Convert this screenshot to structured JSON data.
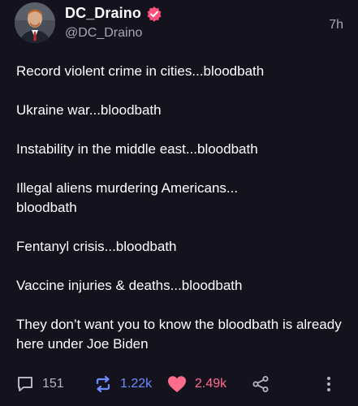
{
  "post": {
    "display_name": "DC_Draino",
    "handle": "@DC_Draino",
    "timestamp": "7h",
    "paragraphs": [
      "Record violent crime in cities...bloodbath",
      "Ukraine war...bloodbath",
      "Instability in the middle east...bloodbath",
      "Illegal aliens murdering Americans...\nbloodbath",
      "Fentanyl crisis...bloodbath",
      "Vaccine injuries & deaths...bloodbath",
      "They don’t want you to know the bloodbath is already here under Joe Biden"
    ]
  },
  "actions": {
    "reply_count": "151",
    "repost_count": "1.22k",
    "like_count": "2.49k"
  },
  "icons": {
    "verified": "verified-badge-icon",
    "reply": "speech-bubble-icon",
    "repost": "repost-arrows-icon",
    "like": "heart-icon",
    "share": "share-icon",
    "more": "vertical-dots-icon"
  },
  "colors": {
    "background": "#14121c",
    "muted_text": "#a9a7b3",
    "repost_active": "#6f8cff",
    "like_active": "#ff6b8a",
    "verified_badge": "#ff4f7d"
  }
}
